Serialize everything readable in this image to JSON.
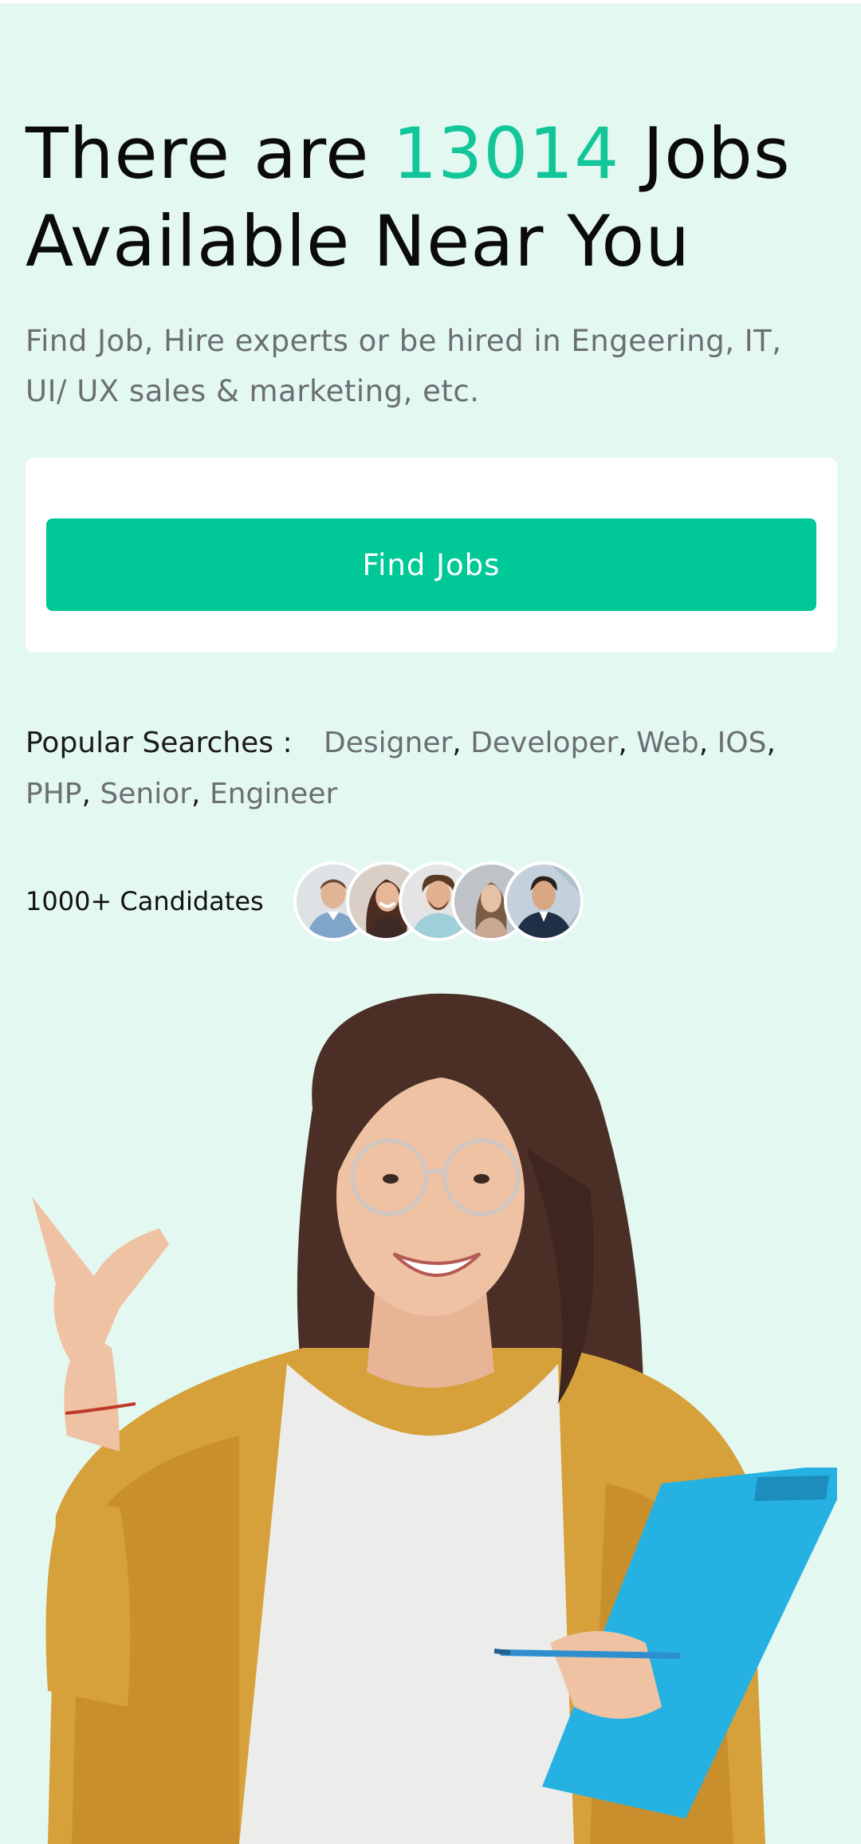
{
  "hero": {
    "title_prefix": "There are ",
    "job_count": "13014",
    "title_middle": " Jobs",
    "title_line2": "Available Near You",
    "subtitle": "Find Job, Hire experts or be hired in Engeering, IT, UI/ UX sales & marketing, etc."
  },
  "search": {
    "button_label": "Find Jobs"
  },
  "popular": {
    "label": "Popular Searches :",
    "tags": [
      "Designer",
      "Developer",
      "Web",
      "IOS",
      "PHP",
      "Senior",
      "Engineer"
    ]
  },
  "candidates": {
    "label": "1000+ Candidates",
    "avatar_count": 5
  },
  "colors": {
    "background": "#e4f8f2",
    "accent": "#12c69a",
    "button": "#00c896"
  },
  "icons": [
    "candidate-avatar",
    "hero-woman-illustration"
  ]
}
